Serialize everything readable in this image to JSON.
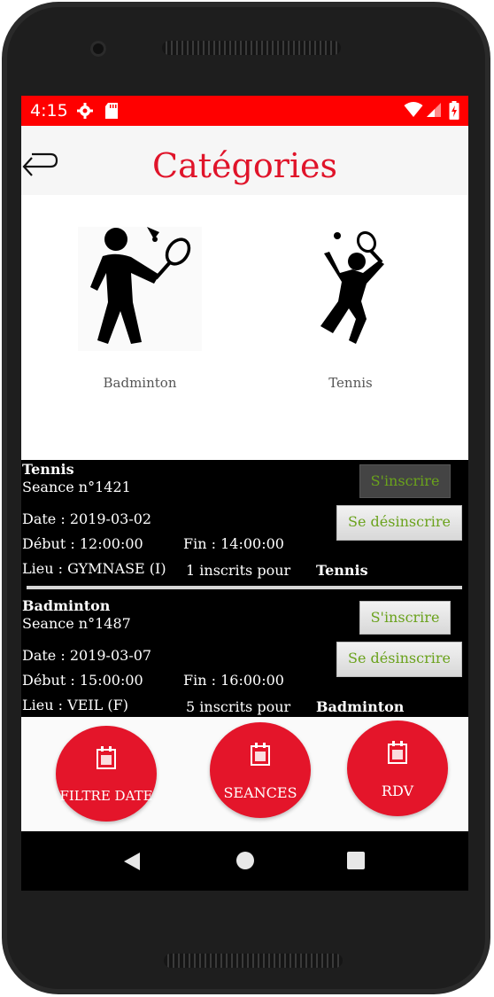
{
  "status_bar": {
    "time": "4:15"
  },
  "app_bar": {
    "title": "Catégories"
  },
  "categories": [
    {
      "label": "Badminton",
      "icon": "badminton-player-icon"
    },
    {
      "label": "Tennis",
      "icon": "tennis-player-icon"
    }
  ],
  "sessions": [
    {
      "sport": "Tennis",
      "seance": "Seance n°1421",
      "date": "Date : 2019-03-02",
      "debut": "Début : 12:00:00",
      "fin": "Fin : 14:00:00",
      "lieu": "Lieu : GYMNASE (I)",
      "inscrits": "1 inscrits pour",
      "inscrits_sport": "Tennis",
      "register_label": "S'inscrire",
      "unregister_label": "Se désinscrire"
    },
    {
      "sport": "Badminton",
      "seance": "Seance n°1487",
      "date": "Date : 2019-03-07",
      "debut": "Début : 15:00:00",
      "fin": "Fin : 16:00:00",
      "lieu": "Lieu : VEIL (F)",
      "inscrits": "5 inscrits pour",
      "inscrits_sport": "Badminton",
      "register_label": "S'inscrire",
      "unregister_label": "Se désinscrire"
    }
  ],
  "bottom_actions": [
    {
      "label": "FILTRE DATE",
      "icon": "calendar-icon"
    },
    {
      "label": "SEANCES",
      "icon": "calendar-icon"
    },
    {
      "label": "RDV",
      "icon": "calendar-icon"
    }
  ],
  "colors": {
    "accent": "#e4152a",
    "status_bar": "#ff0000",
    "button_text": "#6aa21c"
  }
}
